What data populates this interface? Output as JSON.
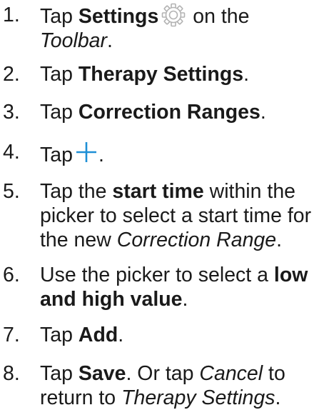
{
  "steps": [
    {
      "number": "1.",
      "parts": [
        {
          "t": "Tap ",
          "s": "n"
        },
        {
          "t": "Settings",
          "s": "b"
        },
        {
          "icon": "gear-icon"
        },
        {
          "t": " on the",
          "s": "n"
        },
        {
          "br": true
        },
        {
          "t": "Toolbar",
          "s": "i"
        },
        {
          "t": ".",
          "s": "n"
        }
      ]
    },
    {
      "number": "2.",
      "parts": [
        {
          "t": "Tap ",
          "s": "n"
        },
        {
          "t": "Therapy Settings",
          "s": "b"
        },
        {
          "t": ".",
          "s": "n"
        }
      ]
    },
    {
      "number": "3.",
      "parts": [
        {
          "t": "Tap ",
          "s": "n"
        },
        {
          "t": "Correction Ranges",
          "s": "b"
        },
        {
          "t": ".",
          "s": "n"
        }
      ]
    },
    {
      "number": "4.",
      "parts": [
        {
          "t": "Tap",
          "s": "n"
        },
        {
          "icon": "plus-icon"
        },
        {
          "t": ".",
          "s": "n"
        }
      ]
    },
    {
      "number": "5.",
      "parts": [
        {
          "t": "Tap the ",
          "s": "n"
        },
        {
          "t": "start time",
          "s": "b"
        },
        {
          "t": " within the",
          "s": "n"
        },
        {
          "br": true
        },
        {
          "t": "picker to select a start time for",
          "s": "n"
        },
        {
          "br": true
        },
        {
          "t": "the new ",
          "s": "n"
        },
        {
          "t": "Correction Range",
          "s": "i"
        },
        {
          "t": ".",
          "s": "n"
        }
      ]
    },
    {
      "number": "6.",
      "parts": [
        {
          "t": "Use the picker to select a ",
          "s": "n"
        },
        {
          "t": "low",
          "s": "b"
        },
        {
          "br": true
        },
        {
          "t": "and high value",
          "s": "b"
        },
        {
          "t": ".",
          "s": "n"
        }
      ]
    },
    {
      "number": "7.",
      "parts": [
        {
          "t": "Tap ",
          "s": "n"
        },
        {
          "t": "Add",
          "s": "b"
        },
        {
          "t": ".",
          "s": "n"
        }
      ]
    },
    {
      "number": "8.",
      "parts": [
        {
          "t": "Tap ",
          "s": "n"
        },
        {
          "t": "Save",
          "s": "b"
        },
        {
          "t": ". Or tap ",
          "s": "n"
        },
        {
          "t": "Cancel",
          "s": "i"
        },
        {
          "t": " to",
          "s": "n"
        },
        {
          "br": true
        },
        {
          "t": "return to ",
          "s": "n"
        },
        {
          "t": "Therapy Settings",
          "s": "i"
        },
        {
          "t": ".",
          "s": "n"
        }
      ]
    }
  ],
  "colors": {
    "text": "#1a1a1a",
    "gear_icon": "#b3b3b3",
    "plus_icon": "#1e8fd6"
  }
}
